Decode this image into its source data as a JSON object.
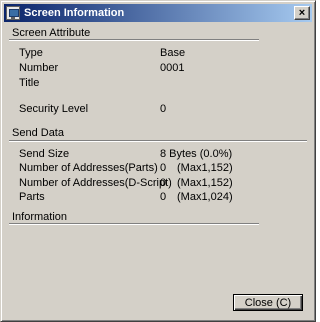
{
  "window": {
    "title": "Screen Information",
    "close_symbol": "×"
  },
  "screen_attribute": {
    "header": "Screen Attribute",
    "rows": [
      {
        "label": "Type",
        "value": "Base"
      },
      {
        "label": "Number",
        "value": "0001"
      },
      {
        "label": "Title",
        "value": ""
      },
      {
        "label": "Security Level",
        "value": "0"
      }
    ]
  },
  "send_data": {
    "header": "Send Data",
    "rows": [
      {
        "label": "Send Size",
        "value": "8 Bytes  (0.0%)",
        "max": ""
      },
      {
        "label": "Number of Addresses(Parts)",
        "value": "0",
        "max": "(Max1,152)"
      },
      {
        "label": "Number of Addresses(D-Script)",
        "value": "0",
        "max": "(Max1,152)"
      },
      {
        "label": "Parts",
        "value": "0",
        "max": "(Max1,024)"
      }
    ]
  },
  "information": {
    "header": "Information"
  },
  "buttons": {
    "close_label": "Close (C)"
  }
}
